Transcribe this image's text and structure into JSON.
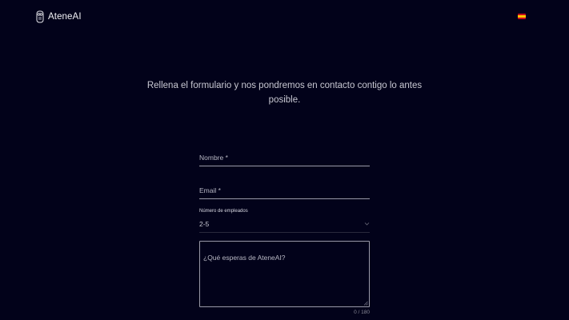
{
  "brand": {
    "name": "AteneAI",
    "icon": "owl-logo-icon"
  },
  "language": {
    "icon": "spain-flag-icon",
    "colors": {
      "red": "#c60b1e",
      "yellow": "#ffc400"
    }
  },
  "intro": {
    "text": "Rellena el formulario y nos pondremos en contacto contigo lo antes posible."
  },
  "form": {
    "name_label": "Nombre *",
    "email_label": "Email *",
    "employees": {
      "label": "Número de empleados",
      "value": "2-5"
    },
    "message": {
      "placeholder": "¿Qué esperas de AteneAI?",
      "counter": "0 / 180"
    }
  },
  "colors": {
    "background": "#02021a",
    "text": "#e8e8ee",
    "border": "#9a9aa8"
  }
}
